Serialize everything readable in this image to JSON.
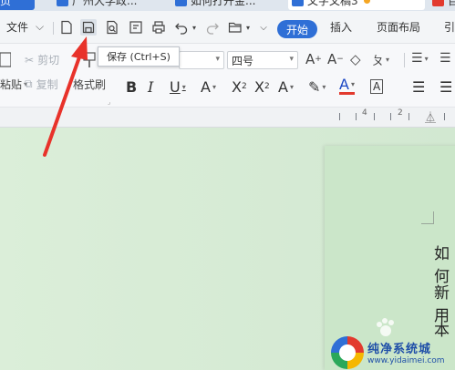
{
  "tabs": [
    {
      "label": "页"
    },
    {
      "label": "广州大学政..."
    },
    {
      "label": "如何打开金..."
    },
    {
      "label": "文字文稿3"
    },
    {
      "label": "百"
    }
  ],
  "menu": {
    "file_label": "文件",
    "start_label": "开始",
    "insert_label": "插入",
    "layout_label": "页面布局",
    "ref_label": "引"
  },
  "ribbon": {
    "cut_label": "剪切",
    "copy_label": "复制",
    "paste_label": "粘贴",
    "format_painter_label": "格式刷",
    "font_size": "四号"
  },
  "tooltip": {
    "text": "保存 (Ctrl+S)"
  },
  "ruler": {
    "labels": [
      "4",
      "2"
    ]
  },
  "document": {
    "lines": [
      "如何",
      "新用",
      "本"
    ]
  },
  "watermark": {
    "title": "纯净系统城",
    "url": "www.yidaimei.com"
  },
  "colors": {
    "accent": "#2f6fd6",
    "doc_background": "#d2e8d1",
    "arrow": "#e8322a"
  }
}
